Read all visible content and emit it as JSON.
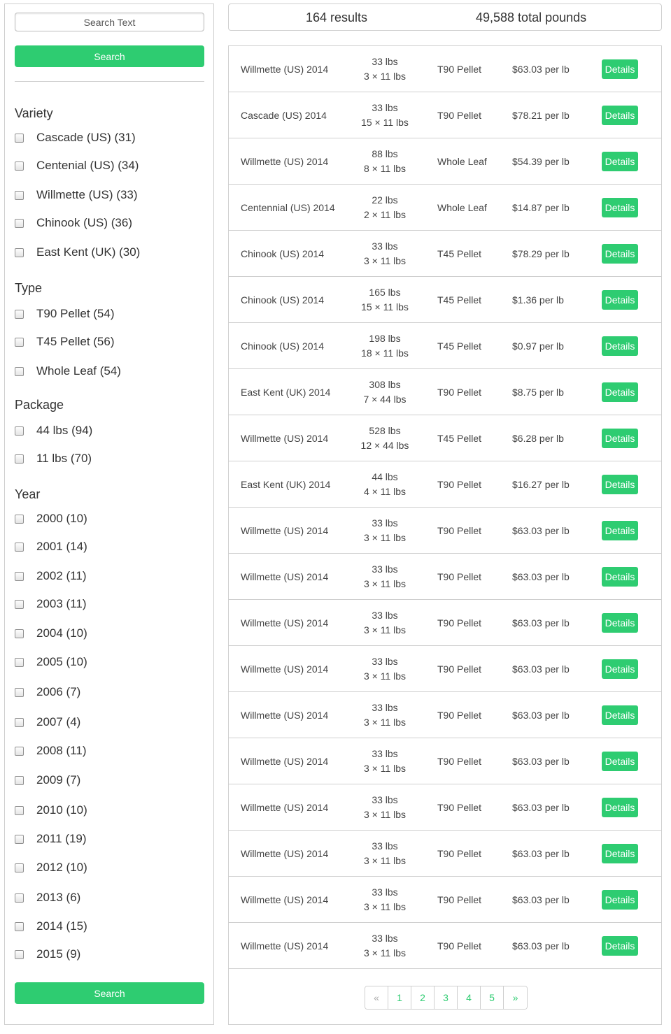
{
  "search": {
    "placeholder": "Search Text",
    "button_label": "Search"
  },
  "filters": {
    "variety": {
      "title": "Variety",
      "items": [
        "Cascade (US) (31)",
        "Centenial (US) (34)",
        "Willmette (US) (33)",
        "Chinook (US) (36)",
        "East Kent (UK) (30)"
      ]
    },
    "type": {
      "title": "Type",
      "items": [
        "T90 Pellet (54)",
        "T45 Pellet (56)",
        "Whole Leaf (54)"
      ]
    },
    "package": {
      "title": "Package",
      "items": [
        "44 lbs (94)",
        "11 lbs (70)"
      ]
    },
    "year": {
      "title": "Year",
      "items": [
        "2000 (10)",
        "2001 (14)",
        "2002 (11)",
        "2003 (11)",
        "2004 (10)",
        "2005 (10)",
        "2006 (7)",
        "2007 (4)",
        "2008 (11)",
        "2009 (7)",
        "2010 (10)",
        "2011 (19)",
        "2012 (10)",
        "2013 (6)",
        "2014 (15)",
        "2015 (9)"
      ]
    }
  },
  "summary": {
    "results": "164 results",
    "total": "49,588 total pounds"
  },
  "rows": [
    {
      "name": "Willmette (US) 2014",
      "weight": "33 lbs",
      "package": "3 × 11 lbs",
      "type": "T90 Pellet",
      "price": "$63.03 per lb",
      "action": "Details"
    },
    {
      "name": "Cascade (US) 2014",
      "weight": "33 lbs",
      "package": "15 × 11 lbs",
      "type": "T90 Pellet",
      "price": "$78.21 per lb",
      "action": "Details"
    },
    {
      "name": "Willmette (US) 2014",
      "weight": "88 lbs",
      "package": "8 × 11 lbs",
      "type": "Whole Leaf",
      "price": "$54.39 per lb",
      "action": "Details"
    },
    {
      "name": "Centennial (US) 2014",
      "weight": "22 lbs",
      "package": "2 × 11 lbs",
      "type": "Whole Leaf",
      "price": "$14.87 per lb",
      "action": "Details"
    },
    {
      "name": "Chinook (US) 2014",
      "weight": "33 lbs",
      "package": "3 × 11 lbs",
      "type": "T45 Pellet",
      "price": "$78.29 per lb",
      "action": "Details"
    },
    {
      "name": "Chinook (US) 2014",
      "weight": "165 lbs",
      "package": "15 × 11 lbs",
      "type": "T45 Pellet",
      "price": "$1.36 per lb",
      "action": "Details"
    },
    {
      "name": "Chinook (US) 2014",
      "weight": "198 lbs",
      "package": "18 × 11 lbs",
      "type": "T45 Pellet",
      "price": "$0.97 per lb",
      "action": "Details"
    },
    {
      "name": "East Kent (UK) 2014",
      "weight": "308 lbs",
      "package": "7 × 44 lbs",
      "type": "T90 Pellet",
      "price": "$8.75 per lb",
      "action": "Details"
    },
    {
      "name": "Willmette (US) 2014",
      "weight": "528 lbs",
      "package": "12 × 44 lbs",
      "type": "T45 Pellet",
      "price": "$6.28 per lb",
      "action": "Details"
    },
    {
      "name": "East Kent (UK) 2014",
      "weight": "44 lbs",
      "package": "4 × 11 lbs",
      "type": "T90 Pellet",
      "price": "$16.27 per lb",
      "action": "Details"
    },
    {
      "name": "Willmette (US) 2014",
      "weight": "33 lbs",
      "package": "3 × 11 lbs",
      "type": "T90 Pellet",
      "price": "$63.03 per lb",
      "action": "Details"
    },
    {
      "name": "Willmette (US) 2014",
      "weight": "33 lbs",
      "package": "3 × 11 lbs",
      "type": "T90 Pellet",
      "price": "$63.03 per lb",
      "action": "Details"
    },
    {
      "name": "Willmette (US) 2014",
      "weight": "33 lbs",
      "package": "3 × 11 lbs",
      "type": "T90 Pellet",
      "price": "$63.03 per lb",
      "action": "Details"
    },
    {
      "name": "Willmette (US) 2014",
      "weight": "33 lbs",
      "package": "3 × 11 lbs",
      "type": "T90 Pellet",
      "price": "$63.03 per lb",
      "action": "Details"
    },
    {
      "name": "Willmette (US) 2014",
      "weight": "33 lbs",
      "package": "3 × 11 lbs",
      "type": "T90 Pellet",
      "price": "$63.03 per lb",
      "action": "Details"
    },
    {
      "name": "Willmette (US) 2014",
      "weight": "33 lbs",
      "package": "3 × 11 lbs",
      "type": "T90 Pellet",
      "price": "$63.03 per lb",
      "action": "Details"
    },
    {
      "name": "Willmette (US) 2014",
      "weight": "33 lbs",
      "package": "3 × 11 lbs",
      "type": "T90 Pellet",
      "price": "$63.03 per lb",
      "action": "Details"
    },
    {
      "name": "Willmette (US) 2014",
      "weight": "33 lbs",
      "package": "3 × 11 lbs",
      "type": "T90 Pellet",
      "price": "$63.03 per lb",
      "action": "Details"
    },
    {
      "name": "Willmette (US) 2014",
      "weight": "33 lbs",
      "package": "3 × 11 lbs",
      "type": "T90 Pellet",
      "price": "$63.03 per lb",
      "action": "Details"
    },
    {
      "name": "Willmette (US) 2014",
      "weight": "33 lbs",
      "package": "3 × 11 lbs",
      "type": "T90 Pellet",
      "price": "$63.03 per lb",
      "action": "Details"
    }
  ],
  "pagination": {
    "prev": "«",
    "pages": [
      "1",
      "2",
      "3",
      "4",
      "5"
    ],
    "next": "»"
  },
  "colors": {
    "accent": "#2ecc71",
    "border": "#cfcfcf"
  }
}
